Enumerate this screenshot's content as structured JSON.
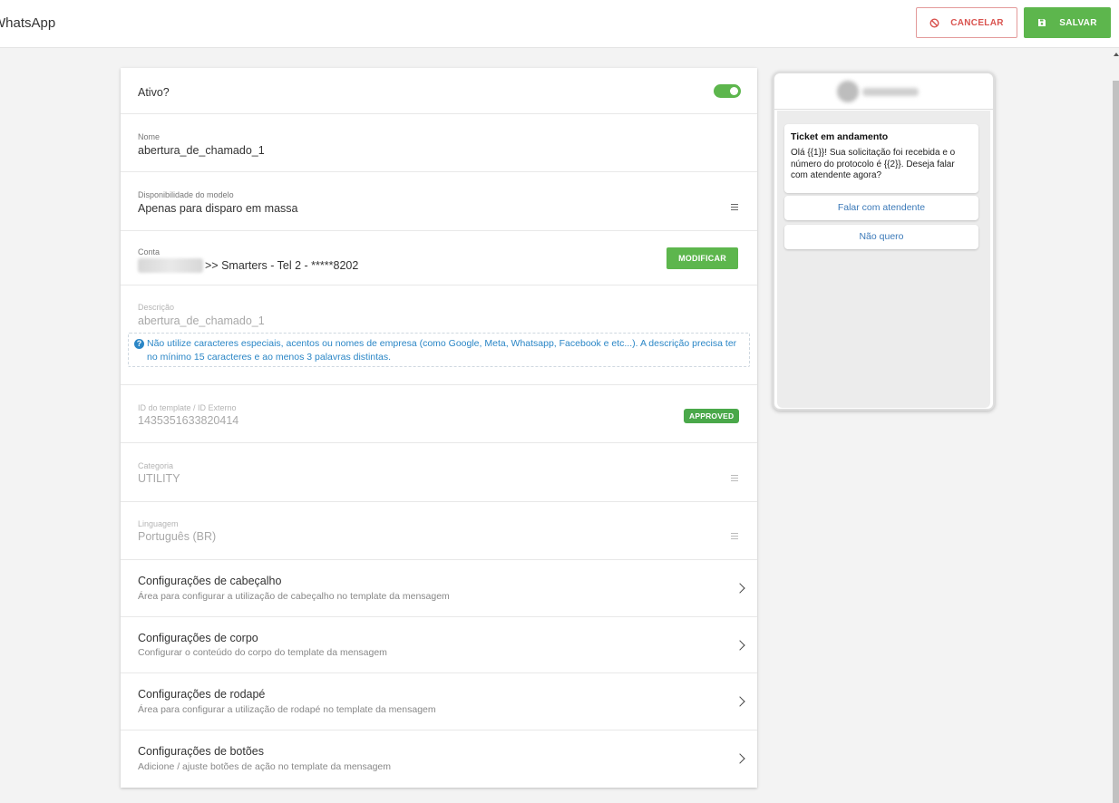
{
  "header": {
    "title": "WhatsApp",
    "cancel_label": "CANCELAR",
    "save_label": "SALVAR"
  },
  "form": {
    "active_label": "Ativo?",
    "active_value": true,
    "name": {
      "label": "Nome",
      "value": "abertura_de_chamado_1"
    },
    "availability": {
      "label": "Disponibilidade do modelo",
      "value": "Apenas para disparo em massa"
    },
    "account": {
      "label": "Conta",
      "value": ">> Smarters - Tel 2 - *****8202",
      "modify_label": "MODIFICAR"
    },
    "description": {
      "label": "Descrição",
      "value": "abertura_de_chamado_1",
      "hint": "Não utilize caracteres especiais, acentos ou nomes de empresa (como Google, Meta, Whatsapp, Facebook e etc...). A descrição precisa ter no mínimo 15 caracteres e ao menos 3 palavras distintas."
    },
    "template_id": {
      "label": "ID do template / ID Externo",
      "value": "1435351633820414",
      "status": "APPROVED"
    },
    "category": {
      "label": "Categoria",
      "value": "UTILITY"
    },
    "language": {
      "label": "Linguagem",
      "value": "Português (BR)"
    }
  },
  "sections": [
    {
      "title": "Configurações de cabeçalho",
      "subtitle": "Área para configurar a utilização de cabeçalho no template da mensagem"
    },
    {
      "title": "Configurações de corpo",
      "subtitle": "Configurar o conteúdo do corpo do template da mensagem"
    },
    {
      "title": "Configurações de rodapé",
      "subtitle": "Área para configurar a utilização de rodapé no template da mensagem"
    },
    {
      "title": "Configurações de botões",
      "subtitle": "Adicione / ajuste botões de ação no template da mensagem"
    }
  ],
  "preview": {
    "message_title": "Ticket em andamento",
    "message_body": "Olá {{1}}! Sua solicitação foi recebida e o número do protocolo é {{2}}. Deseja falar com atendente agora?",
    "buttons": [
      "Falar com atendente",
      "Não quero"
    ]
  },
  "colors": {
    "accent_green": "#5db64d",
    "cancel_red": "#d9534f",
    "hint_blue": "#2a86c6"
  }
}
